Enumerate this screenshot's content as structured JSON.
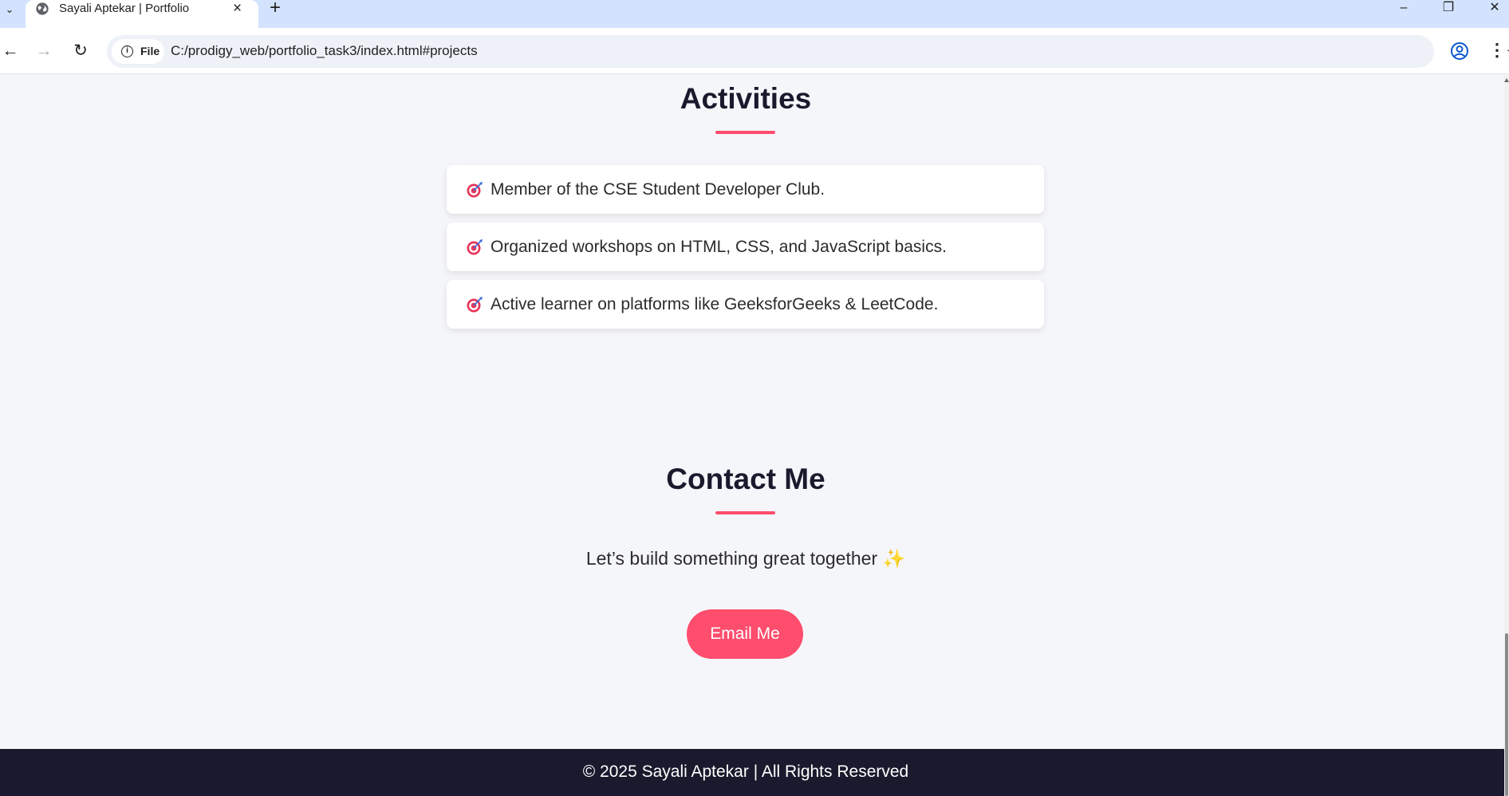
{
  "browser": {
    "tab_title": "Sayali Aptekar | Portfolio",
    "site_chip_label": "File",
    "url": "C:/prodigy_web/portfolio_task3/index.html#projects"
  },
  "activities": {
    "title": "Activities",
    "items": [
      {
        "text": "Member of the CSE Student Developer Club."
      },
      {
        "text": "Organized workshops on HTML, CSS, and JavaScript basics."
      },
      {
        "text": "Active learner on platforms like GeeksforGeeks & LeetCode."
      }
    ]
  },
  "contact": {
    "title": "Contact Me",
    "tagline": "Let’s build something great together",
    "tagline_emoji": "✨",
    "email_button_label": "Email Me"
  },
  "footer": {
    "text": "© 2025 Sayali Aptekar | All Rights Reserved"
  },
  "colors": {
    "accent": "#ff4d6d",
    "dark": "#1a1a2e",
    "page_bg": "#f5f6fa",
    "tab_strip": "#d3e3fd"
  },
  "icons": {
    "activity_bullet": "target-dart-icon"
  }
}
